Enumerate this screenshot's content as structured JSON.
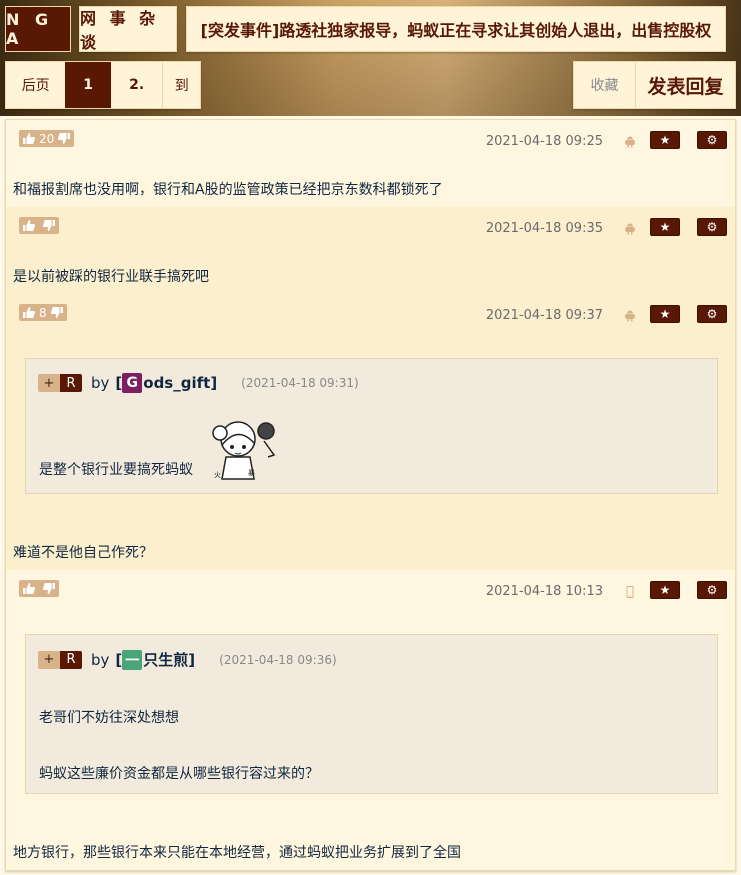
{
  "header": {
    "logo": "N G A",
    "forum": "网 事 杂 谈",
    "thread_title": "[突发事件]路透社独家报导，蚂蚁正在寻求让其创始人退出，出售控股权"
  },
  "pager": {
    "back": "后页",
    "page1": "1",
    "page2": "2.",
    "goto": "到"
  },
  "actions": {
    "favorite": "收藏",
    "reply": "发表回复"
  },
  "icons": {
    "star": "star-icon",
    "gear": "gear-icon"
  },
  "posts": [
    {
      "votes": "20",
      "time": "2021-04-18 09:25",
      "device": "android",
      "text": "和福报割席也没用啊，银行和A股的监管政策已经把京东数科都锁死了"
    },
    {
      "votes": "",
      "time": "2021-04-18 09:35",
      "device": "android",
      "text": "是以前被踩的银行业联手搞死吧"
    },
    {
      "votes": "8",
      "time": "2021-04-18 09:37",
      "device": "android",
      "quote": {
        "plus": "+",
        "r": "R",
        "by": "by",
        "avatar_letter": "G",
        "avatar_color": "#7b1f5f",
        "user_rest": "ods_gift",
        "bracket_open": "[",
        "bracket_close": "]",
        "time": "(2021-04-18 09:31)",
        "text": "是整个银行业要搞死蚂蚁"
      },
      "text": "难道不是他自己作死？"
    },
    {
      "votes": "",
      "time": "2021-04-18 10:13",
      "device": "iphone",
      "quote": {
        "plus": "+",
        "r": "R",
        "by": "by",
        "avatar_letter": "一",
        "avatar_color": "#4aa57a",
        "user_rest": "只生煎",
        "bracket_open": "[",
        "bracket_close": "]",
        "time": "(2021-04-18 09:36)",
        "text": "老哥们不妨往深处想想",
        "text2": "蚂蚁这些廉价资金都是从哪些银行容过来的？"
      },
      "text": "地方银行，那些银行本来只能在本地经营，通过蚂蚁把业务扩展到了全国"
    }
  ],
  "colors": {
    "brand_dark": "#591804",
    "panel": "#fff3d8",
    "post_light": "#fff6e0",
    "post_alt": "#fcefcd",
    "quote_bg": "#f2ebdd",
    "vote_bg": "#d8b38a"
  }
}
